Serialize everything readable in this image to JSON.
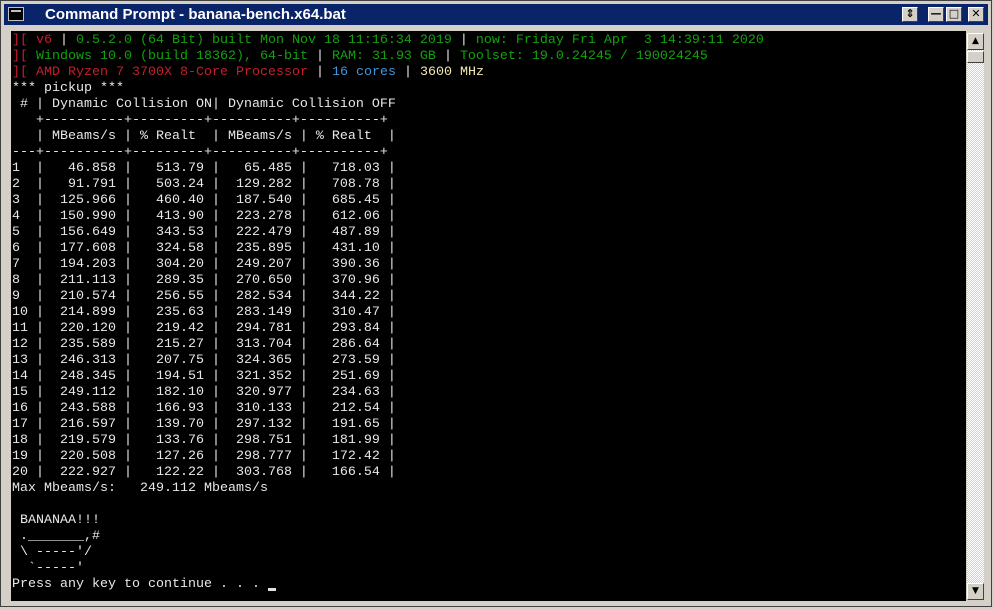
{
  "window": {
    "title": "Command Prompt - banana-bench.x64.bat"
  },
  "header": {
    "line1": {
      "bracket": "][",
      "version": "v6",
      "sep": "|",
      "build": "0.5.2.0 (64 Bit) built Mon Nov 18 11:16:34 2019",
      "sep2": "|",
      "now": "now: Friday Fri Apr  3 14:39:11 2020"
    },
    "line2": {
      "bracket": "][",
      "os": "Windows 10.0 (build 18362), 64-bit",
      "sep": "|",
      "ram": "RAM: 31.93 GB",
      "sep2": "|",
      "toolset": "Toolset: 19.0.24245 / 190024245"
    },
    "line3": {
      "bracket": "][",
      "cpu": "AMD Ryzen 7 3700X 8-Core Processor",
      "sep": "|",
      "cores": "16 cores",
      "sep2": "|",
      "mhz": "3600 MHz"
    }
  },
  "table": {
    "heading": "*** pickup ***",
    "header_row1": " # | Dynamic Collision ON| Dynamic Collision OFF",
    "sep1": "   +----------+---------+----------+----------+",
    "header_row2": "   | MBeams/s | % Realt  | MBeams/s | % Realt  |",
    "sep2": "---+----------+---------+----------+----------+",
    "rows": [
      "1  |   46.858 |   513.79 |   65.485 |   718.03 |",
      "2  |   91.791 |   503.24 |  129.282 |   708.78 |",
      "3  |  125.966 |   460.40 |  187.540 |   685.45 |",
      "4  |  150.990 |   413.90 |  223.278 |   612.06 |",
      "5  |  156.649 |   343.53 |  222.479 |   487.89 |",
      "6  |  177.608 |   324.58 |  235.895 |   431.10 |",
      "7  |  194.203 |   304.20 |  249.207 |   390.36 |",
      "8  |  211.113 |   289.35 |  270.650 |   370.96 |",
      "9  |  210.574 |   256.55 |  282.534 |   344.22 |",
      "10 |  214.899 |   235.63 |  283.149 |   310.47 |",
      "11 |  220.120 |   219.42 |  294.781 |   293.84 |",
      "12 |  235.589 |   215.27 |  313.704 |   286.64 |",
      "13 |  246.313 |   207.75 |  324.365 |   273.59 |",
      "14 |  248.345 |   194.51 |  321.352 |   251.69 |",
      "15 |  249.112 |   182.10 |  320.977 |   234.63 |",
      "16 |  243.588 |   166.93 |  310.133 |   212.54 |",
      "17 |  216.597 |   139.70 |  297.132 |   191.65 |",
      "18 |  219.579 |   133.76 |  298.751 |   181.99 |",
      "19 |  220.508 |   127.26 |  298.777 |   172.42 |",
      "20 |  222.927 |   122.22 |  303.768 |   166.54 |"
    ]
  },
  "summary": "Max Mbeams/s:   249.112 Mbeams/s",
  "art": [
    " BANANAA!!!",
    " ._______,#",
    " \\ -----'/",
    "  `-----'"
  ],
  "prompt": "Press any key to continue . . . "
}
